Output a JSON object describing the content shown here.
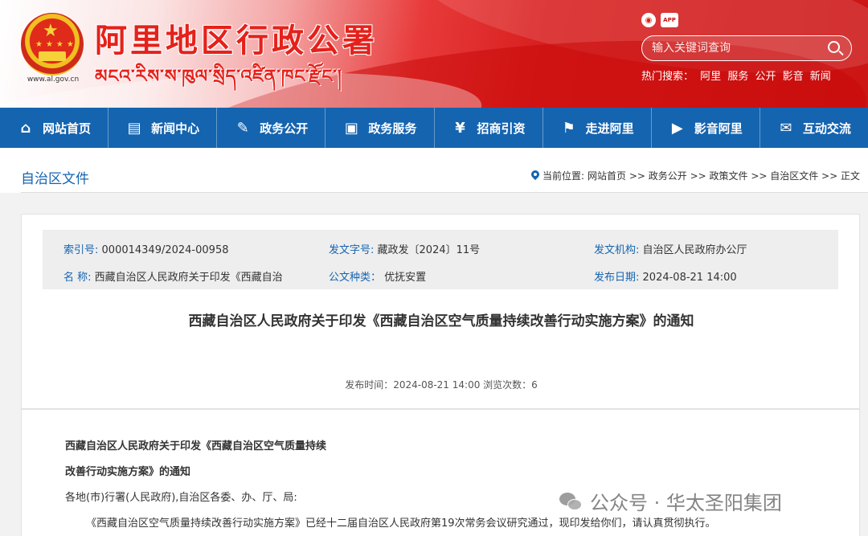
{
  "header": {
    "emblem_url": "www.al.gov.cn",
    "title": "阿里地区行政公署",
    "subtitle": "མངའ་རིས་ས་ཁུལ་སྲིད་འཛིན་ཁང་རྫོང་།",
    "icons": {
      "weibo": "weibo-icon",
      "app": "APP"
    },
    "search": {
      "placeholder": "输入关键词查询"
    },
    "hot_search": {
      "label": "热门搜索：",
      "terms": [
        "阿里",
        "服务",
        "公开",
        "影音",
        "新闻"
      ]
    }
  },
  "nav": {
    "items": [
      {
        "label": "网站首页",
        "icon": "home-icon"
      },
      {
        "label": "新闻中心",
        "icon": "news-icon"
      },
      {
        "label": "政务公开",
        "icon": "edit-icon"
      },
      {
        "label": "政务服务",
        "icon": "service-icon"
      },
      {
        "label": "招商引资",
        "icon": "investment-icon"
      },
      {
        "label": "走进阿里",
        "icon": "flag-icon"
      },
      {
        "label": "影音阿里",
        "icon": "video-icon"
      },
      {
        "label": "互动交流",
        "icon": "chat-icon"
      }
    ]
  },
  "breadcrumb": {
    "section_title": "自治区文件",
    "prefix": "当前位置:",
    "path": "网站首页 >> 政务公开 >> 政策文件 >> 自治区文件 >> 正文"
  },
  "meta": {
    "index_key": "索引号:",
    "index_value": "000014349/2024-00958",
    "doc_no_key": "发文字号:",
    "doc_no_value": "藏政发〔2024〕11号",
    "issuer_key": "发文机构:",
    "issuer_value": "自治区人民政府办公厅",
    "name_key": "名  称:",
    "name_value": "西藏自治区人民政府关于印发《西藏自治",
    "category_key": "公文种类：",
    "category_value": "优抚安置",
    "date_key": "发布日期:",
    "date_value": "2024-08-21 14:00"
  },
  "article": {
    "title": "西藏自治区人民政府关于印发《西藏自治区空气质量持续改善行动实施方案》的通知",
    "pub_info": "发布时间：2024-08-21 14:00 浏览次数：6",
    "heading_line1": "西藏自治区人民政府关于印发《西藏自治区空气质量持续",
    "heading_line2": "改善行动实施方案》的通知",
    "addressee": "各地(市)行署(人民政府),自治区各委、办、厅、局:",
    "paragraph1": "《西藏自治区空气质量持续改善行动实施方案》已经十二届自治区人民政府第19次常务会议研究通过，现印发给你们，请认真贯彻执行。"
  },
  "watermark": {
    "text": "公众号 · 华太圣阳集团"
  }
}
